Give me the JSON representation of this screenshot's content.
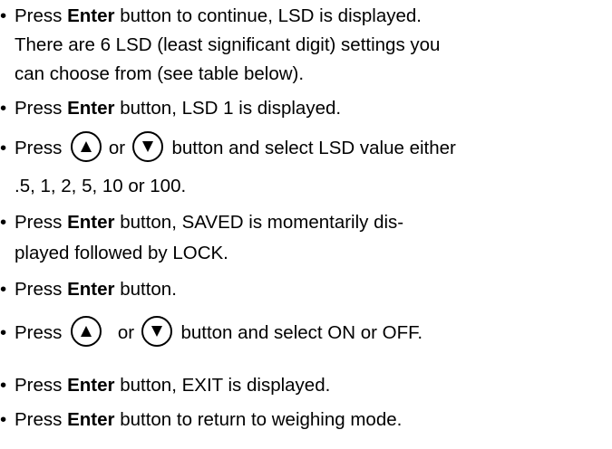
{
  "bullet": "•",
  "items": [
    {
      "l1a": "Press ",
      "l1b": "Enter",
      "l1c": " button to continue, LSD is displayed.",
      "l2": "There are 6 LSD  (least significant digit) settings you",
      "l3": "can choose from (see table below)."
    },
    {
      "a": "Press ",
      "b": "Enter",
      "c": " button, LSD  1 is displayed."
    },
    {
      "a": "Press",
      "or": "or",
      "c": "button and select LSD value either",
      "l2": ".5, 1, 2, 5, 10 or 100."
    },
    {
      "a": "Press ",
      "b": "Enter",
      "c": " button, SAVED is momentarily dis-",
      "l2": "played followed by LOCK."
    },
    {
      "a": "Press ",
      "b": "Enter",
      "c": " button."
    },
    {
      "a": "Press",
      "or": "or",
      "c": "button and select ON or OFF."
    },
    {
      "a": "Press ",
      "b": "Enter",
      "c": " button, EXIT is displayed."
    },
    {
      "a": "Press ",
      "b": "Enter",
      "c": " button to return to weighing mode."
    }
  ],
  "icons": {
    "up": "up-arrow-button-icon",
    "down": "down-arrow-button-icon"
  }
}
